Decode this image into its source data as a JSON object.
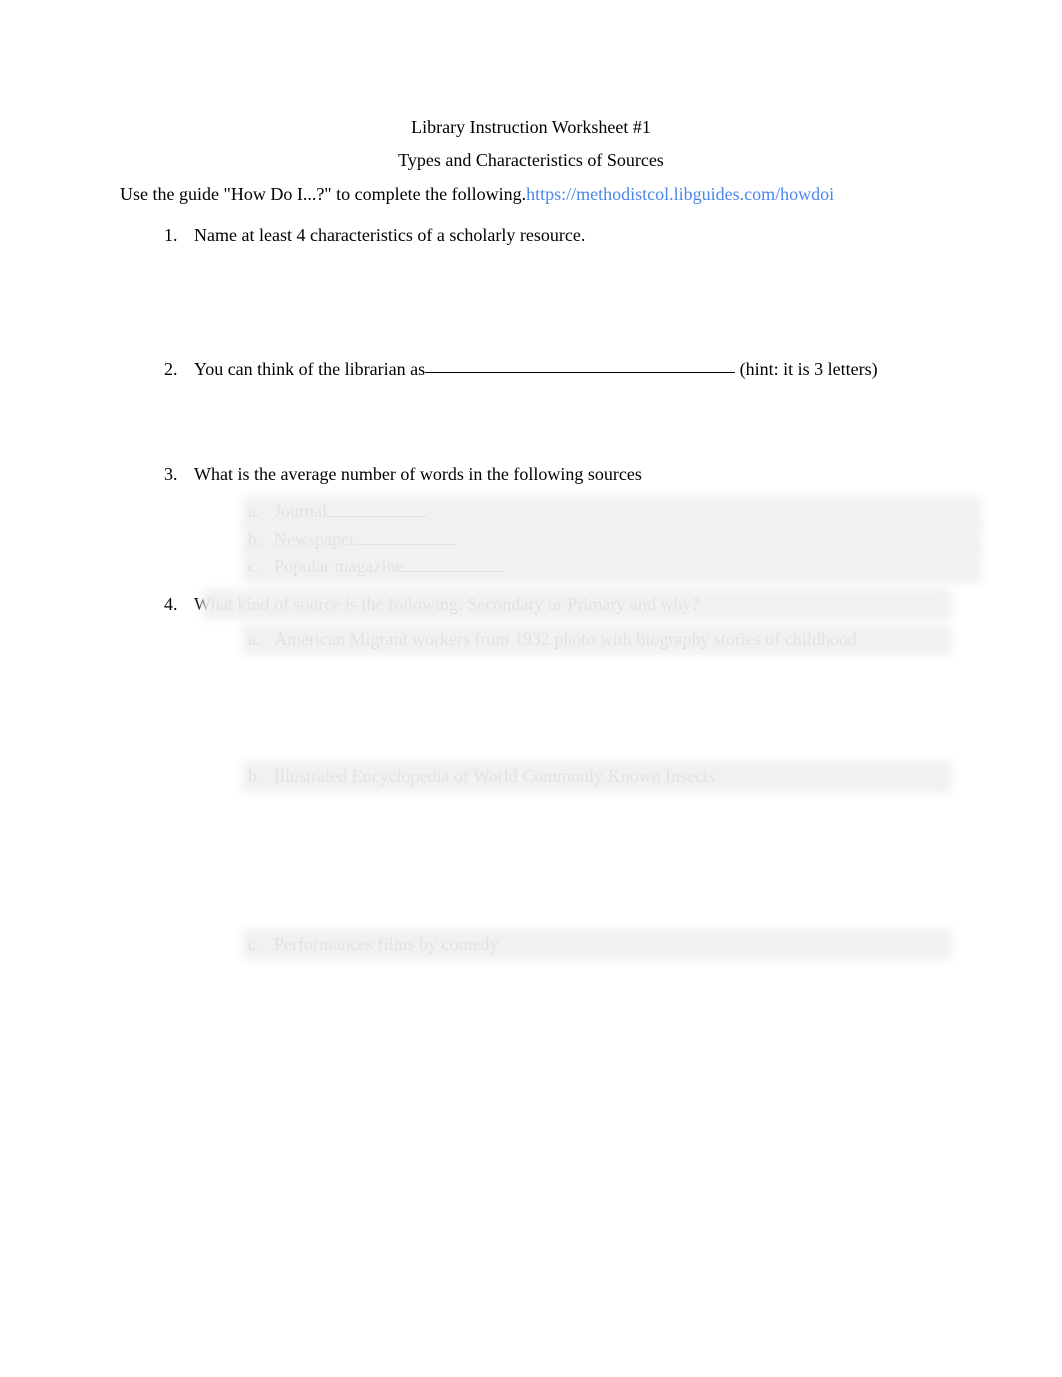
{
  "header": {
    "title1": "Library Instruction Worksheet #1",
    "title2": "Types and Characteristics of Sources"
  },
  "intro": {
    "prefix": "Use the guide \"How Do I...?\" to complete the following.",
    "link": "https://methodistcol.libguides.com/howdoi"
  },
  "questions": {
    "q1": {
      "num": "1.",
      "text": "Name at least 4 characteristics of a scholarly resource."
    },
    "q2": {
      "num": "2.",
      "prefix": "You can think of the librarian as",
      "suffix": " (hint: it is 3 letters)"
    },
    "q3": {
      "num": "3.",
      "text": "What is the average number of words in the following sources",
      "subs": {
        "a": {
          "letter": "a.",
          "label": "Journal"
        },
        "b": {
          "letter": "b.",
          "label": "Newspaper"
        },
        "c": {
          "letter": "c.",
          "label": "Popular magazine"
        }
      }
    },
    "q4": {
      "num": "4.",
      "text": "What kind of source is the following: Secondary or Primary and why?",
      "subs": {
        "a": {
          "letter": "a.",
          "label": "American Migrant workers from 1932 photo with biography stories of childhood"
        },
        "b": {
          "letter": "b.",
          "label": "Illustrated Encyclopedia of World Commonly Known Insects"
        },
        "c": {
          "letter": "c.",
          "label": "Performances films by comedy"
        }
      }
    }
  }
}
